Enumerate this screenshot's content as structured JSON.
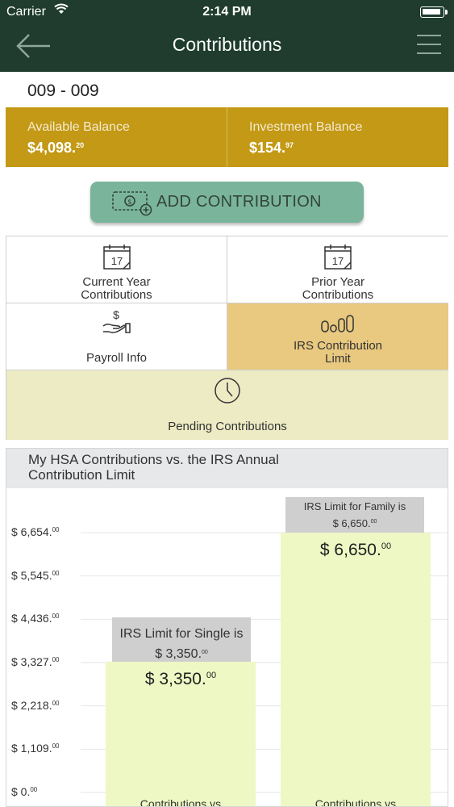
{
  "status_bar": {
    "carrier": "Carrier",
    "time": "2:14 PM"
  },
  "nav": {
    "title": "Contributions"
  },
  "account": {
    "id": "009 - 009"
  },
  "balances": [
    {
      "label": "Available Balance",
      "amount": "$4,098.",
      "cents": "20"
    },
    {
      "label": "Investment Balance",
      "amount": "$154.",
      "cents": "97"
    }
  ],
  "actions": {
    "add_contribution": "ADD CONTRIBUTION"
  },
  "tiles": {
    "current_year": {
      "line1": "Current Year",
      "line2": "Contributions",
      "day": "17"
    },
    "prior_year": {
      "line1": "Prior Year",
      "line2": "Contributions",
      "day": "17"
    },
    "payroll": {
      "label": "Payroll Info"
    },
    "irs_limit": {
      "line1": "IRS Contribution",
      "line2": "Limit"
    },
    "pending": {
      "label": "Pending Contributions"
    }
  },
  "colors": {
    "nav": "#1f3c2e",
    "gold": "#c39915",
    "button": "#7ab59b",
    "selected_tile": "#e8c97f",
    "pending_tile": "#ecebc4",
    "bar": "#eef8c4"
  },
  "chart_data": {
    "type": "bar",
    "title_line1": "My HSA Contributions vs. the IRS Annual",
    "title_line2": "Contribution Limit",
    "ylim": [
      0,
      6654
    ],
    "yticks": [
      {
        "value": 0,
        "text": "$ 0.",
        "cents": "00"
      },
      {
        "value": 1109,
        "text": "$ 1,109.",
        "cents": "00"
      },
      {
        "value": 2218,
        "text": "$ 2,218.",
        "cents": "00"
      },
      {
        "value": 3327,
        "text": "$ 3,327.",
        "cents": "00"
      },
      {
        "value": 4436,
        "text": "$ 4,436.",
        "cents": "00"
      },
      {
        "value": 5545,
        "text": "$ 5,545.",
        "cents": "00"
      },
      {
        "value": 6654,
        "text": "$ 6,654.",
        "cents": "00"
      }
    ],
    "bars": [
      {
        "category": "Contributions vs",
        "value": 3350,
        "value_text": "$ 3,350.",
        "cents": "00",
        "tip_line1": "IRS Limit for Single is",
        "tip_line2": "$ 3,350.",
        "tip_cents": "00"
      },
      {
        "category": "Contributions vs",
        "value": 6650,
        "value_text": "$ 6,650.",
        "cents": "00",
        "tip_line1": "IRS Limit for Family is",
        "tip_line2": "$ 6,650.",
        "tip_cents": "00"
      }
    ]
  }
}
